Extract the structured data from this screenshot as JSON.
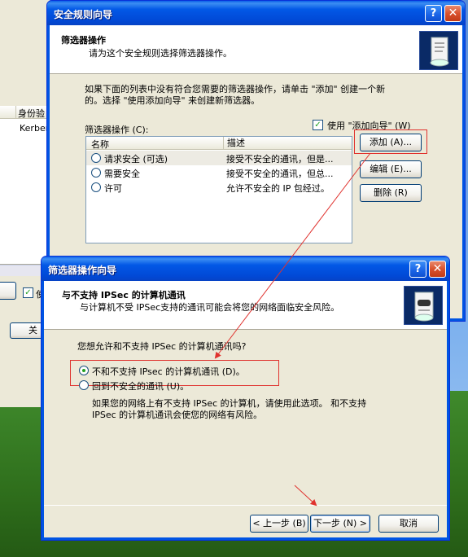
{
  "back_window": {
    "column_auth": "身份验",
    "cell_kerberos": "Kerber",
    "check_label": "使",
    "close_button": "关"
  },
  "rule_wizard": {
    "title": "安全规则向导",
    "header_title": "筛选器操作",
    "header_subtitle": "请为这个安全规则选择筛选器操作。",
    "intro_line1": "如果下面的列表中没有符合您需要的筛选器操作，请单击 \"添加\" 创建一个新",
    "intro_line2": "的。选择 \"使用添加向导\" 来创建新筛选器。",
    "use_wizard_label": "使用 \"添加向导\" (W)",
    "use_wizard_checked": true,
    "list_label": "筛选器操作 (C):",
    "columns": {
      "name": "名称",
      "desc": "描述"
    },
    "rows": [
      {
        "name": "请求安全 (可选)",
        "desc": "接受不安全的通讯，但是..."
      },
      {
        "name": "需要安全",
        "desc": "接受不安全的通讯，但总..."
      },
      {
        "name": "许可",
        "desc": "允许不安全的 IP 包经过。"
      }
    ],
    "buttons": {
      "add": "添加 (A)...",
      "edit": "编辑 (E)...",
      "remove": "删除 (R)"
    }
  },
  "filter_wizard": {
    "title": "筛选器操作向导",
    "header_title": "与不支持 IPSec 的计算机通讯",
    "header_subtitle": "与计算机不受 IPSec支持的通讯可能会将您的网络面临安全风险。",
    "question": "您想允许和不支持 IPSec 的计算机通讯吗?",
    "option_no": "不和不支持 IPsec 的计算机通讯 (D)。",
    "option_fallback": "回到不安全的通讯 (U)。",
    "option_selected": "option_no",
    "note_line1": "如果您的网络上有不支持 IPSec 的计算机，请使用此选项。 和不支持",
    "note_line2": "IPSec 的计算机通讯会使您的网络有风险。",
    "buttons": {
      "back": "< 上一步 (B)",
      "next": "下一步 (N) >",
      "cancel": "取消"
    }
  },
  "colors": {
    "annotation_red": "#e0322e",
    "xp_blue": "#0054e3"
  }
}
